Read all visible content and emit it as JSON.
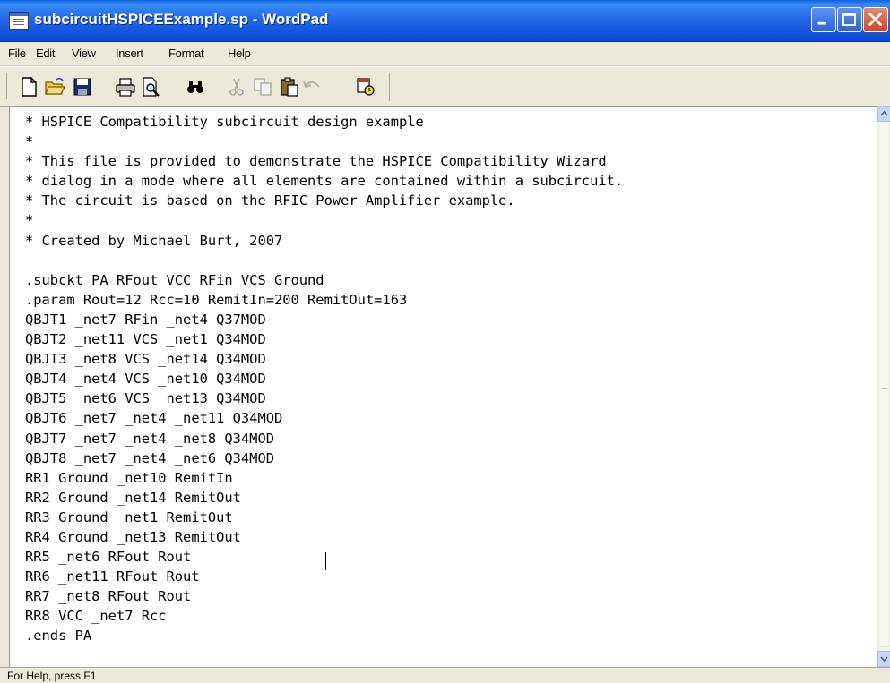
{
  "window": {
    "title": "subcircuitHSPICEExample.sp - WordPad",
    "accent": "#2468e8",
    "close_color": "#d0441e"
  },
  "menu": {
    "items": [
      {
        "label": "File"
      },
      {
        "label": "Edit"
      },
      {
        "label": "View"
      },
      {
        "label": "Insert"
      },
      {
        "label": "Format"
      },
      {
        "label": "Help"
      }
    ]
  },
  "toolbar": {
    "buttons": [
      {
        "icon": "new-document-icon"
      },
      {
        "icon": "open-folder-icon"
      },
      {
        "icon": "save-disk-icon"
      },
      {
        "icon": "print-icon"
      },
      {
        "icon": "print-preview-icon"
      },
      {
        "icon": "find-binoculars-icon"
      },
      {
        "icon": "cut-scissors-icon"
      },
      {
        "icon": "copy-icon"
      },
      {
        "icon": "paste-icon"
      },
      {
        "icon": "undo-icon"
      },
      {
        "icon": "date-time-icon"
      }
    ]
  },
  "document": {
    "lines": [
      "* HSPICE Compatibility subcircuit design example",
      "*",
      "* This file is provided to demonstrate the HSPICE Compatibility Wizard",
      "* dialog in a mode where all elements are contained within a subcircuit.",
      "* The circuit is based on the RFIC Power Amplifier example.",
      "*",
      "* Created by Michael Burt, 2007",
      "",
      ".subckt PA RFout VCC RFin VCS Ground",
      ".param Rout=12 Rcc=10 RemitIn=200 RemitOut=163",
      "QBJT1 _net7 RFin _net4 Q37MOD",
      "QBJT2 _net11 VCS _net1 Q34MOD",
      "QBJT3 _net8 VCS _net14 Q34MOD",
      "QBJT4 _net4 VCS _net10 Q34MOD",
      "QBJT5 _net6 VCS _net13 Q34MOD",
      "QBJT6 _net7 _net4 _net11 Q34MOD",
      "QBJT7 _net7 _net4 _net8 Q34MOD",
      "QBJT8 _net7 _net4 _net6 Q34MOD",
      "RR1 Ground _net10 RemitIn",
      "RR2 Ground _net14 RemitOut",
      "RR3 Ground _net1 RemitOut",
      "RR4 Ground _net13 RemitOut",
      "RR5 _net6 RFout Rout",
      "RR6 _net11 RFout Rout",
      "RR7 _net8 RFout Rout",
      "RR8 VCC _net7 Rcc",
      ".ends PA"
    ]
  },
  "status": {
    "text": "For Help, press F1"
  }
}
